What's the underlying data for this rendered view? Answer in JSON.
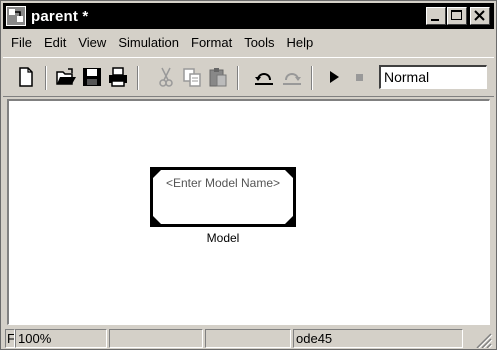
{
  "window": {
    "title": "parent *"
  },
  "menu": {
    "items": [
      "File",
      "Edit",
      "View",
      "Simulation",
      "Format",
      "Tools",
      "Help"
    ]
  },
  "toolbar": {
    "icons": [
      "new-icon",
      "open-icon",
      "save-icon",
      "print-icon",
      "cut-icon",
      "copy-icon",
      "paste-icon",
      "undo-icon",
      "redo-icon",
      "start-simulation-icon",
      "stop-simulation-icon"
    ],
    "sim_mode_value": "Normal"
  },
  "canvas": {
    "block": {
      "text": "<Enter Model Name>",
      "label": "Model"
    }
  },
  "status": {
    "left": "F",
    "zoom": "100%",
    "solver": "ode45"
  },
  "colors": {
    "titlebar": "#000000",
    "chrome": "#d4d0c8",
    "canvas": "#ffffff"
  }
}
